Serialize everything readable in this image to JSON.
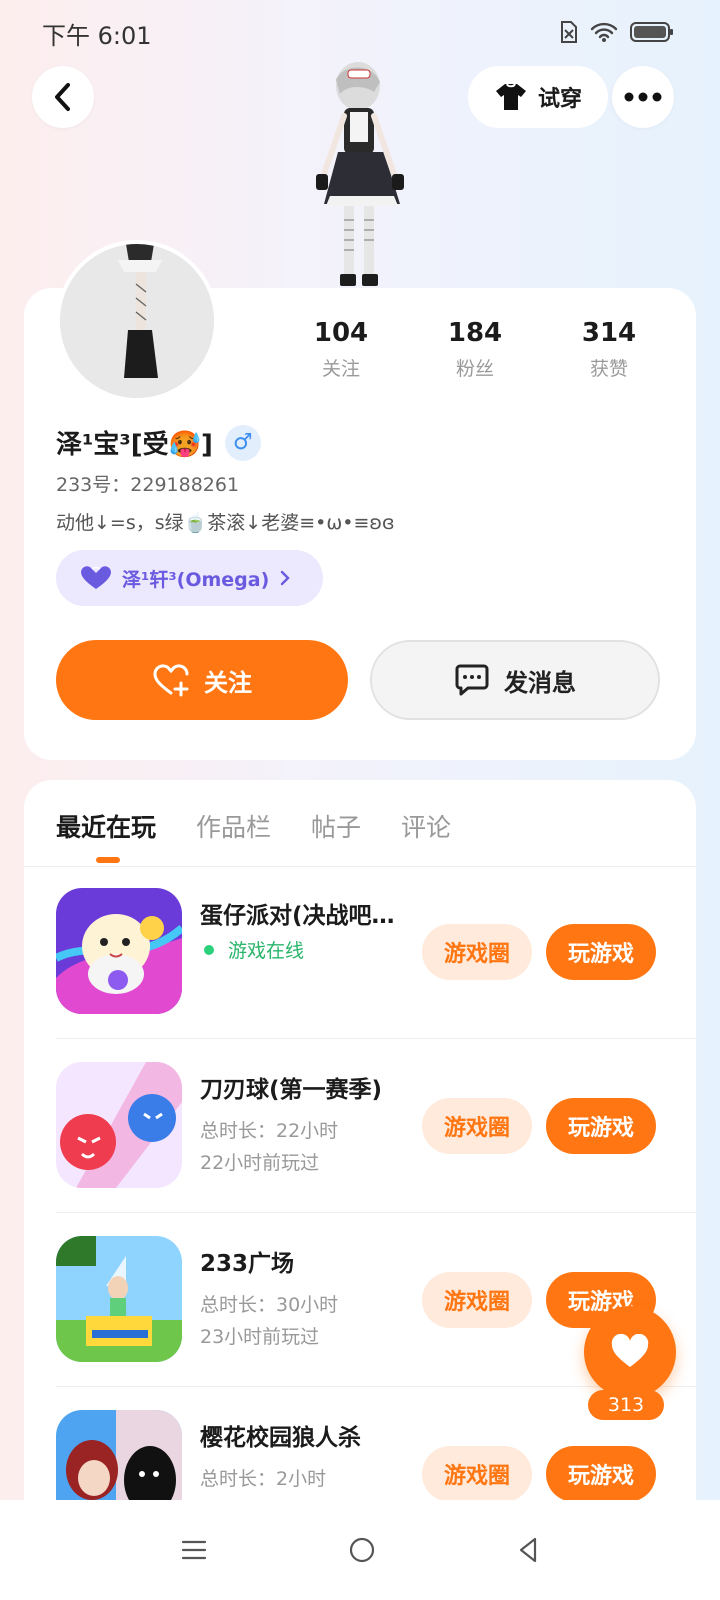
{
  "status_bar": {
    "time": "下午 6:01"
  },
  "header": {
    "try_on_label": "试穿"
  },
  "stats": [
    {
      "value": "104",
      "label": "关注"
    },
    {
      "value": "184",
      "label": "粉丝"
    },
    {
      "value": "314",
      "label": "获赞"
    }
  ],
  "profile": {
    "name": "泽¹宝³[受🥵]",
    "gender_symbol": "♂",
    "uid": "233号：229188261",
    "bio": "动他↓=s，s绿🍵茶滚↓老婆≡•ω•≡ʚɞ",
    "partner": "泽¹轩³(Omega)"
  },
  "actions": {
    "follow_label": "关注",
    "message_label": "发消息"
  },
  "tabs": [
    {
      "label": "最近在玩",
      "active": true
    },
    {
      "label": "作品栏",
      "active": false
    },
    {
      "label": "帖子",
      "active": false
    },
    {
      "label": "评论",
      "active": false
    }
  ],
  "games": [
    {
      "title": "蛋仔派对(决战吧…",
      "status": "游戏在线",
      "circle_label": "游戏圈",
      "play_label": "玩游戏"
    },
    {
      "title": "刀刃球(第一赛季)",
      "duration": "总时长：22小时",
      "last_played": "22小时前玩过",
      "circle_label": "游戏圈",
      "play_label": "玩游戏"
    },
    {
      "title": "233广场",
      "duration": "总时长：30小时",
      "last_played": "23小时前玩过",
      "circle_label": "游戏圈",
      "play_label": "玩游戏"
    },
    {
      "title": "樱花校园狼人杀",
      "duration": "总时长：2小时",
      "circle_label": "游戏圈",
      "play_label": "玩游戏"
    }
  ],
  "like_fab": {
    "count": "313"
  },
  "colors": {
    "accent": "#ff7612",
    "online": "#28b56a",
    "partner": "#6a5ae0"
  }
}
